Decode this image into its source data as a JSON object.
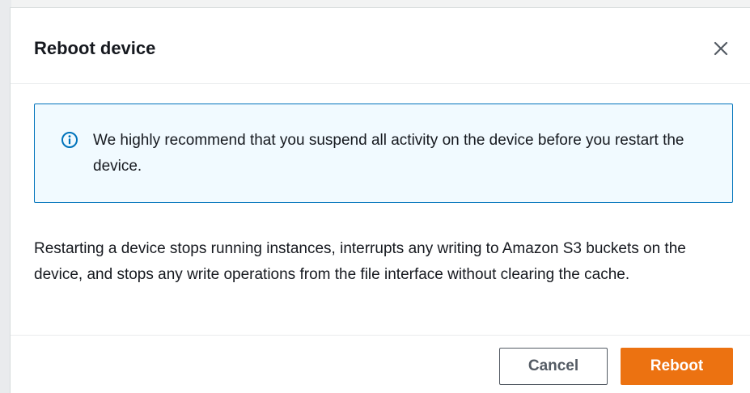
{
  "dialog": {
    "title": "Reboot device",
    "close_icon": "close-icon"
  },
  "alert": {
    "icon": "info-icon",
    "message": "We highly recommend that you suspend all activity on the device before you restart the device.",
    "border_color": "#0073bb",
    "background_color": "#f1faff"
  },
  "body": {
    "description": "Restarting a device stops running instances, interrupts any writing to Amazon S3 buckets on the device, and stops any write operations from the file interface without clearing the cache."
  },
  "footer": {
    "cancel_label": "Cancel",
    "reboot_label": "Reboot",
    "primary_color": "#ec7211"
  }
}
